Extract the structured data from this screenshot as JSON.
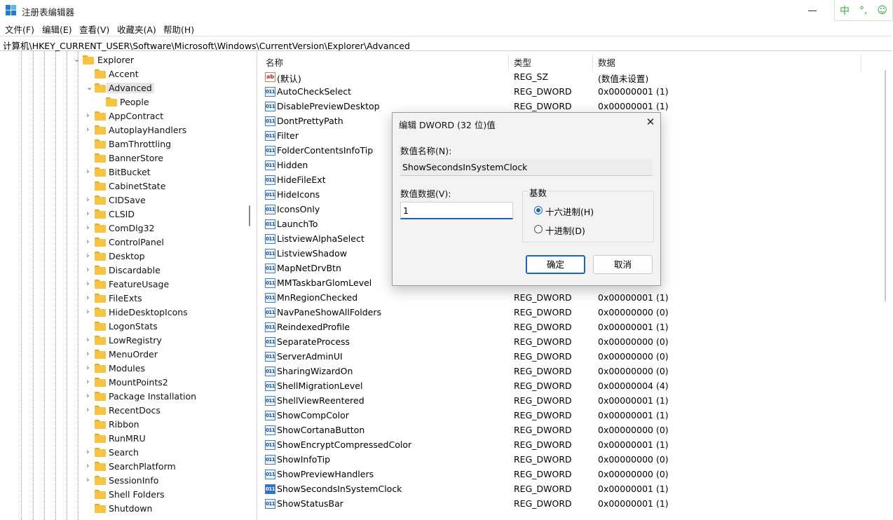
{
  "window": {
    "title": "注册表编辑器",
    "ime": [
      "中",
      "°,",
      "☺"
    ]
  },
  "menu": [
    "文件(F)",
    "编辑(E)",
    "查看(V)",
    "收藏夹(A)",
    "帮助(H)"
  ],
  "address": "计算机\\HKEY_CURRENT_USER\\Software\\Microsoft\\Windows\\CurrentVersion\\Explorer\\Advanced",
  "tree": {
    "explorer": "Explorer",
    "items": [
      {
        "label": "Accent",
        "expandable": false,
        "level": 1
      },
      {
        "label": "Advanced",
        "expandable": true,
        "expanded": true,
        "selected": true,
        "level": 1
      },
      {
        "label": "People",
        "expandable": false,
        "level": 2
      },
      {
        "label": "AppContract",
        "expandable": true,
        "level": 1
      },
      {
        "label": "AutoplayHandlers",
        "expandable": true,
        "level": 1
      },
      {
        "label": "BamThrottling",
        "expandable": false,
        "level": 1
      },
      {
        "label": "BannerStore",
        "expandable": false,
        "level": 1
      },
      {
        "label": "BitBucket",
        "expandable": true,
        "level": 1
      },
      {
        "label": "CabinetState",
        "expandable": false,
        "level": 1
      },
      {
        "label": "CIDSave",
        "expandable": true,
        "level": 1
      },
      {
        "label": "CLSID",
        "expandable": true,
        "level": 1
      },
      {
        "label": "ComDlg32",
        "expandable": true,
        "level": 1
      },
      {
        "label": "ControlPanel",
        "expandable": true,
        "level": 1
      },
      {
        "label": "Desktop",
        "expandable": true,
        "level": 1
      },
      {
        "label": "Discardable",
        "expandable": true,
        "level": 1
      },
      {
        "label": "FeatureUsage",
        "expandable": true,
        "level": 1
      },
      {
        "label": "FileExts",
        "expandable": true,
        "level": 1
      },
      {
        "label": "HideDesktopIcons",
        "expandable": true,
        "level": 1
      },
      {
        "label": "LogonStats",
        "expandable": false,
        "level": 1
      },
      {
        "label": "LowRegistry",
        "expandable": true,
        "level": 1
      },
      {
        "label": "MenuOrder",
        "expandable": true,
        "level": 1
      },
      {
        "label": "Modules",
        "expandable": true,
        "level": 1
      },
      {
        "label": "MountPoints2",
        "expandable": true,
        "level": 1
      },
      {
        "label": "Package Installation",
        "expandable": true,
        "level": 1
      },
      {
        "label": "RecentDocs",
        "expandable": true,
        "level": 1
      },
      {
        "label": "Ribbon",
        "expandable": false,
        "level": 1
      },
      {
        "label": "RunMRU",
        "expandable": false,
        "level": 1
      },
      {
        "label": "Search",
        "expandable": true,
        "level": 1
      },
      {
        "label": "SearchPlatform",
        "expandable": true,
        "level": 1
      },
      {
        "label": "SessionInfo",
        "expandable": true,
        "level": 1
      },
      {
        "label": "Shell Folders",
        "expandable": false,
        "level": 1
      },
      {
        "label": "Shutdown",
        "expandable": false,
        "level": 1
      }
    ]
  },
  "list": {
    "headers": {
      "name": "名称",
      "type": "类型",
      "data": "数据"
    },
    "rows": [
      {
        "name": "(默认)",
        "type": "REG_SZ",
        "data": "(数值未设置)",
        "icon": "sz"
      },
      {
        "name": "AutoCheckSelect",
        "type": "REG_DWORD",
        "data": "0x00000001 (1)",
        "icon": "dword"
      },
      {
        "name": "DisablePreviewDesktop",
        "type": "REG_DWORD",
        "data": "0x00000001 (1)",
        "icon": "dword"
      },
      {
        "name": "DontPrettyPath",
        "type": "",
        "data": "",
        "icon": "dword"
      },
      {
        "name": "Filter",
        "type": "",
        "data": "",
        "icon": "dword"
      },
      {
        "name": "FolderContentsInfoTip",
        "type": "",
        "data": "",
        "icon": "dword"
      },
      {
        "name": "Hidden",
        "type": "",
        "data": "",
        "icon": "dword"
      },
      {
        "name": "HideFileExt",
        "type": "",
        "data": "",
        "icon": "dword"
      },
      {
        "name": "HideIcons",
        "type": "",
        "data": "",
        "icon": "dword"
      },
      {
        "name": "IconsOnly",
        "type": "",
        "data": "",
        "icon": "dword"
      },
      {
        "name": "LaunchTo",
        "type": "",
        "data": "",
        "icon": "dword"
      },
      {
        "name": "ListviewAlphaSelect",
        "type": "",
        "data": "",
        "icon": "dword"
      },
      {
        "name": "ListviewShadow",
        "type": "",
        "data": "",
        "icon": "dword"
      },
      {
        "name": "MapNetDrvBtn",
        "type": "",
        "data": "",
        "icon": "dword"
      },
      {
        "name": "MMTaskbarGlomLevel",
        "type": "",
        "data": "",
        "icon": "dword"
      },
      {
        "name": "MnRegionChecked",
        "type": "REG_DWORD",
        "data": "0x00000001 (1)",
        "icon": "dword"
      },
      {
        "name": "NavPaneShowAllFolders",
        "type": "REG_DWORD",
        "data": "0x00000000 (0)",
        "icon": "dword"
      },
      {
        "name": "ReindexedProfile",
        "type": "REG_DWORD",
        "data": "0x00000001 (1)",
        "icon": "dword"
      },
      {
        "name": "SeparateProcess",
        "type": "REG_DWORD",
        "data": "0x00000000 (0)",
        "icon": "dword"
      },
      {
        "name": "ServerAdminUI",
        "type": "REG_DWORD",
        "data": "0x00000000 (0)",
        "icon": "dword"
      },
      {
        "name": "SharingWizardOn",
        "type": "REG_DWORD",
        "data": "0x00000000 (0)",
        "icon": "dword"
      },
      {
        "name": "ShellMigrationLevel",
        "type": "REG_DWORD",
        "data": "0x00000004 (4)",
        "icon": "dword"
      },
      {
        "name": "ShellViewReentered",
        "type": "REG_DWORD",
        "data": "0x00000001 (1)",
        "icon": "dword"
      },
      {
        "name": "ShowCompColor",
        "type": "REG_DWORD",
        "data": "0x00000001 (1)",
        "icon": "dword"
      },
      {
        "name": "ShowCortanaButton",
        "type": "REG_DWORD",
        "data": "0x00000000 (0)",
        "icon": "dword"
      },
      {
        "name": "ShowEncryptCompressedColor",
        "type": "REG_DWORD",
        "data": "0x00000001 (1)",
        "icon": "dword"
      },
      {
        "name": "ShowInfoTip",
        "type": "REG_DWORD",
        "data": "0x00000000 (0)",
        "icon": "dword"
      },
      {
        "name": "ShowPreviewHandlers",
        "type": "REG_DWORD",
        "data": "0x00000000 (0)",
        "icon": "dword"
      },
      {
        "name": "ShowSecondsInSystemClock",
        "type": "REG_DWORD",
        "data": "0x00000001 (1)",
        "icon": "dword",
        "highlight": true
      },
      {
        "name": "ShowStatusBar",
        "type": "REG_DWORD",
        "data": "0x00000001 (1)",
        "icon": "dword"
      }
    ]
  },
  "dialog": {
    "title": "编辑 DWORD (32 位)值",
    "value_name_label": "数值名称(N):",
    "value_name": "ShowSecondsInSystemClock",
    "value_data_label": "数值数据(V):",
    "value_data": "1",
    "base_label": "基数",
    "hex_label": "十六进制(H)",
    "dec_label": "十进制(D)",
    "ok_label": "确定",
    "cancel_label": "取消"
  }
}
